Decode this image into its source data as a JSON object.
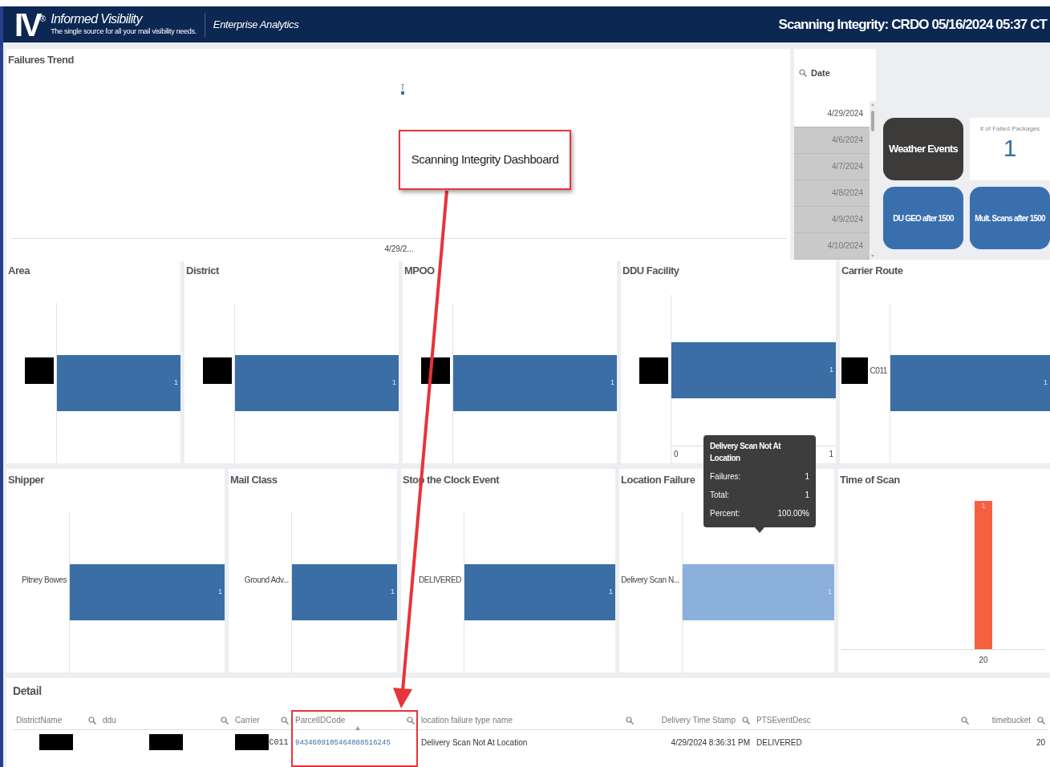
{
  "header": {
    "logo": "IV",
    "logo_mark": "®",
    "brand": "Informed Visibility",
    "tagline": "The single source for all your mail visibility needs.",
    "section": "Enterprise Analytics",
    "title": "Scanning Integrity: CRDO 05/16/2024 05:37 CT"
  },
  "trend": {
    "title": "Failures Trend",
    "x_label": "4/29/2..."
  },
  "date_filter": {
    "title": "Date",
    "items": [
      {
        "label": "4/29/2024",
        "selected": true
      },
      {
        "label": "4/6/2024",
        "selected": false
      },
      {
        "label": "4/7/2024",
        "selected": false
      },
      {
        "label": "4/8/2024",
        "selected": false
      },
      {
        "label": "4/9/2024",
        "selected": false
      },
      {
        "label": "4/10/2024",
        "selected": false
      }
    ]
  },
  "kpi": {
    "buttons": [
      {
        "label": "Weather Events",
        "kind": "dark"
      },
      {
        "label": "DU GEO after 1500",
        "kind": "blue"
      },
      {
        "label": "Mult. Scans after 1500",
        "kind": "blue"
      }
    ],
    "failed": {
      "label": "# of Failed Packages",
      "value": "1"
    }
  },
  "panels": [
    {
      "title": "Area",
      "bars": [
        {
          "redacted": true,
          "value_label": "1",
          "highlighted": false
        }
      ]
    },
    {
      "title": "District",
      "bars": [
        {
          "redacted": true,
          "value_label": "1",
          "highlighted": false
        }
      ]
    },
    {
      "title": "MPOO",
      "bars": [
        {
          "redacted": true,
          "value_label": "1",
          "highlighted": false
        }
      ]
    },
    {
      "title": "DDU Facility",
      "bars": [
        {
          "redacted": true,
          "value_label": "1",
          "highlighted": false
        }
      ],
      "x_ticks": [
        "0",
        "1"
      ]
    },
    {
      "title": "Carrier Route",
      "bars": [
        {
          "redacted": true,
          "label": "C011",
          "value_label": "1",
          "highlighted": false
        }
      ]
    },
    {
      "title": "Shipper",
      "bars": [
        {
          "redacted": false,
          "label": "Pitney Bowes",
          "value_label": "1",
          "highlighted": false
        }
      ]
    },
    {
      "title": "Mail Class",
      "bars": [
        {
          "redacted": false,
          "label": "Ground Adv...",
          "value_label": "1",
          "highlighted": false
        }
      ]
    },
    {
      "title": "Stop the Clock Event",
      "bars": [
        {
          "redacted": false,
          "label": "DELIVERED",
          "value_label": "1",
          "highlighted": false
        }
      ]
    },
    {
      "title": "Location Failure",
      "bars": [
        {
          "redacted": false,
          "label": "Delivery Scan N...",
          "value_label": "1",
          "highlighted": true
        }
      ],
      "tooltip": {
        "title": "Delivery Scan Not At Location",
        "rows": [
          {
            "label": "Failures:",
            "value": "1"
          },
          {
            "label": "Total:",
            "value": "1"
          },
          {
            "label": "Percent:",
            "value": "100.00%"
          }
        ]
      }
    }
  ],
  "time_of_scan": {
    "title": "Time of Scan",
    "bars": [
      {
        "label": "20",
        "value_label": "1"
      }
    ]
  },
  "detail": {
    "title": "Detail",
    "columns": [
      {
        "label": "DistrictName",
        "kind": "text",
        "sorted": false
      },
      {
        "label": "ddu",
        "kind": "text",
        "sorted": false
      },
      {
        "label": "Carrier",
        "kind": "text",
        "sorted": false
      },
      {
        "label": "ParcelIDCode",
        "kind": "text",
        "sorted": true
      },
      {
        "label": "location failure type name",
        "kind": "text",
        "sorted": false
      },
      {
        "label": "Delivery Time Stamp",
        "kind": "number",
        "sorted": false
      },
      {
        "label": "PTSEventDesc",
        "kind": "text",
        "sorted": false
      },
      {
        "label": "timebucket",
        "kind": "number",
        "sorted": false
      }
    ],
    "rows": [
      {
        "cells": [
          {
            "kind": "redacted"
          },
          {
            "kind": "redacted"
          },
          {
            "kind": "redacted",
            "text": "C011"
          },
          {
            "kind": "link",
            "text": "9434609105464088516245"
          },
          {
            "kind": "text",
            "text": "Delivery Scan Not At Location"
          },
          {
            "kind": "text",
            "text": "4/29/2024 8:36:31 PM"
          },
          {
            "kind": "text",
            "text": "DELIVERED"
          },
          {
            "kind": "text",
            "text": "20"
          }
        ]
      }
    ]
  },
  "annotation": {
    "label": "Scanning Integrity Dashboard"
  }
}
